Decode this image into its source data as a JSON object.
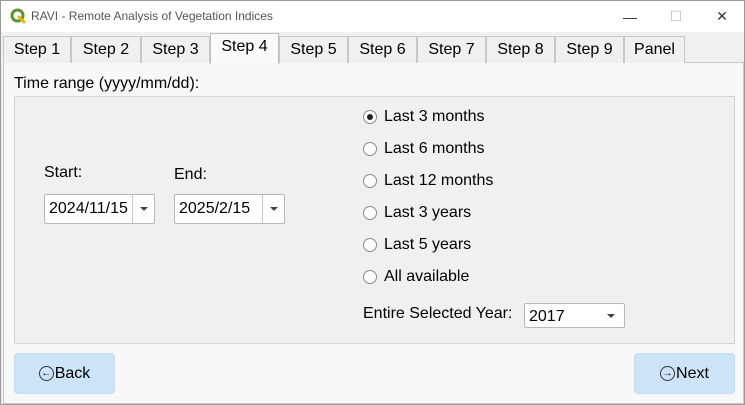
{
  "window": {
    "title": "RAVI - Remote Analysis of Vegetation Indices",
    "minimize_glyph": "—",
    "maximize_glyph": "☐",
    "close_glyph": "✕"
  },
  "tabs": [
    {
      "label": "Step 1",
      "active": false
    },
    {
      "label": "Step 2",
      "active": false
    },
    {
      "label": "Step 3",
      "active": false
    },
    {
      "label": "Step 4",
      "active": true
    },
    {
      "label": "Step 5",
      "active": false
    },
    {
      "label": "Step 6",
      "active": false
    },
    {
      "label": "Step 7",
      "active": false
    },
    {
      "label": "Step 8",
      "active": false
    },
    {
      "label": "Step 9",
      "active": false
    },
    {
      "label": "Panel",
      "active": false
    }
  ],
  "time_range": {
    "label": "Time range (yyyy/mm/dd):",
    "start_label": "Start:",
    "start_value": "2024/11/15",
    "end_label": "End:",
    "end_value": "2025/2/15"
  },
  "presets": {
    "options": [
      {
        "label": "Last 3 months",
        "checked": true
      },
      {
        "label": "Last 6 months",
        "checked": false
      },
      {
        "label": "Last 12 months",
        "checked": false
      },
      {
        "label": "Last 3 years",
        "checked": false
      },
      {
        "label": "Last 5 years",
        "checked": false
      },
      {
        "label": "All available",
        "checked": false
      }
    ],
    "year_label": "Entire Selected Year:",
    "year_value": "2017"
  },
  "footer": {
    "back_label": "Back",
    "next_label": "Next"
  },
  "colors": {
    "button_bg": "#cce4f7",
    "app_icon_green": "#589632"
  }
}
